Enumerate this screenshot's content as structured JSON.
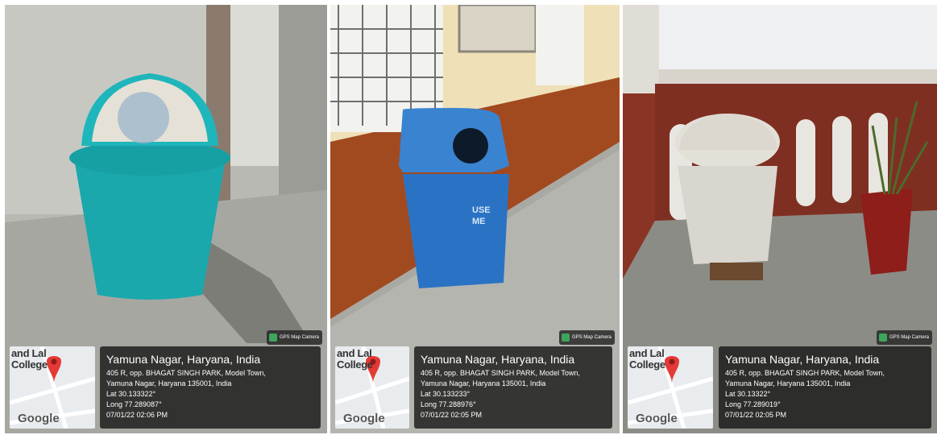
{
  "photos": [
    {
      "bin_color": "#1aa8ad",
      "badge": "GPS Map Camera",
      "map_label": [
        "and Lal",
        "College"
      ],
      "map_brand": "Google",
      "city": "Yamuna Nagar, Haryana, India",
      "address1": "405 R, opp. BHAGAT SINGH PARK, Model Town,",
      "address2": "Yamuna Nagar, Haryana 135001, India",
      "lat": "Lat 30.133322°",
      "long": "Long 77.289087°",
      "datetime": "07/01/22 02:06 PM"
    },
    {
      "bin_color": "#2a73c4",
      "bin_text": [
        "USE",
        "ME"
      ],
      "badge": "GPS Map Camera",
      "map_label": [
        "and Lal",
        "College"
      ],
      "map_brand": "Google",
      "city": "Yamuna Nagar, Haryana, India",
      "address1": "405 R, opp. BHAGAT SINGH PARK, Model Town,",
      "address2": "Yamuna Nagar, Haryana 135001, India",
      "lat": "Lat 30.133233°",
      "long": "Long 77.288976°",
      "datetime": "07/01/22 02:05 PM"
    },
    {
      "bin_color": "#d9d6cf",
      "badge": "GPS Map Camera",
      "map_label": [
        "and Lal",
        "College"
      ],
      "map_brand": "Google",
      "city": "Yamuna Nagar, Haryana, India",
      "address1": "405 R, opp. BHAGAT SINGH PARK, Model Town,",
      "address2": "Yamuna Nagar, Haryana 135001, India",
      "lat": "Lat 30.13322°",
      "long": "Long 77.289019°",
      "datetime": "07/01/22 02:05 PM"
    }
  ]
}
